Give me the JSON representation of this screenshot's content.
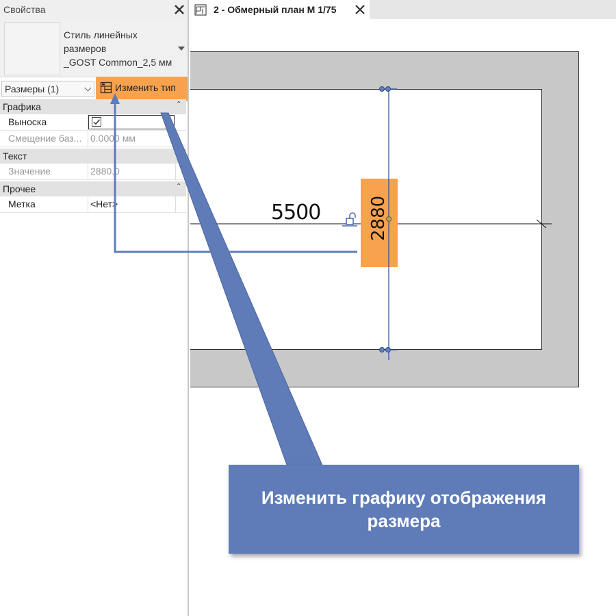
{
  "panel": {
    "title": "Свойства",
    "type_selector": {
      "name_lines": [
        "Стиль линейных",
        "размеров",
        "_GOST Common_2,5 мм"
      ]
    },
    "filter": {
      "label": "Размеры (1)"
    },
    "edit_type_button": {
      "label": "Изменить тип"
    },
    "sections": [
      {
        "label": "Графика",
        "rows": [
          {
            "name": "Выноска",
            "checked": true
          },
          {
            "name": "Смещение баз...",
            "value": "0.0000 мм"
          }
        ]
      },
      {
        "label": "Текст",
        "rows": [
          {
            "name": "Значение",
            "value": "2880.0"
          }
        ]
      },
      {
        "label": "Прочее",
        "rows": [
          {
            "name": "Метка",
            "value": "<Нет>"
          }
        ]
      }
    ]
  },
  "view_tab": {
    "label": "2 - Обмерный план М 1/75"
  },
  "drawing": {
    "horizontal_dimension": "5500",
    "vertical_dimension": "2880"
  },
  "callout": {
    "lines": [
      "Изменить графику отображения",
      "размера"
    ]
  },
  "colors": {
    "highlight": "#f7a24f",
    "callout": "#5f7cb8",
    "dimension_line": "#2b4f9e",
    "wall": "#c8c8c8"
  }
}
